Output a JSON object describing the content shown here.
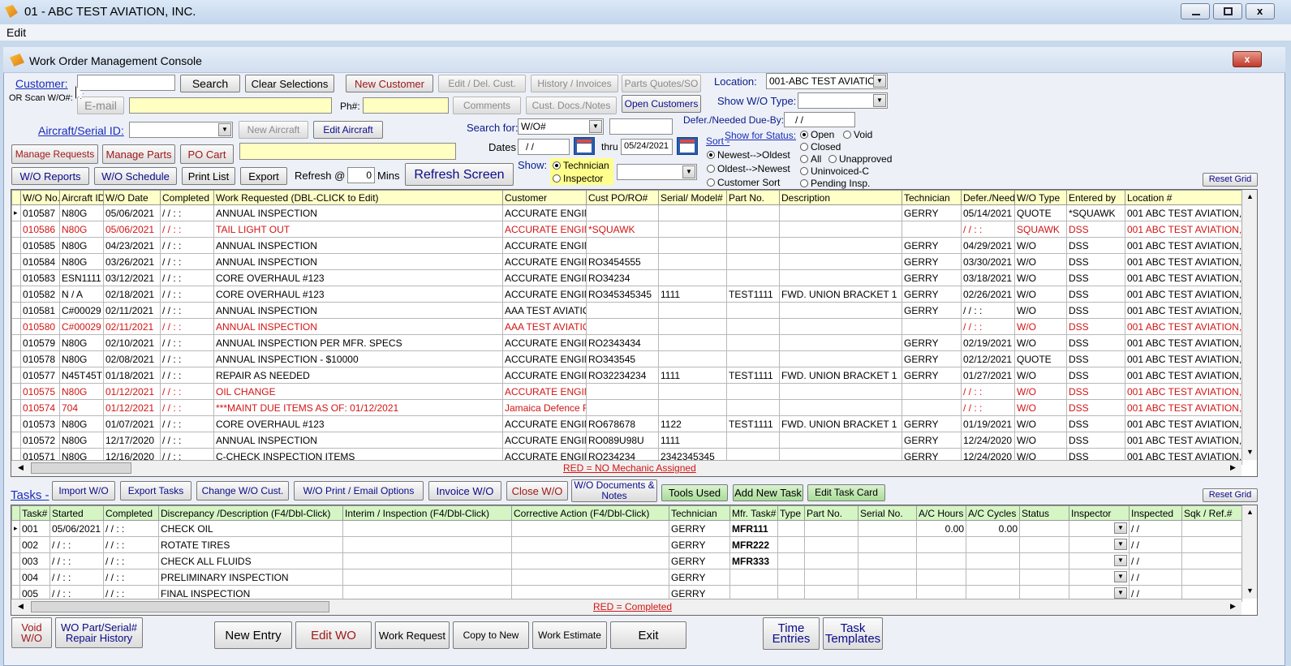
{
  "window": {
    "title": "01 - ABC TEST AVIATION, INC."
  },
  "menu": {
    "edit": "Edit"
  },
  "console": {
    "title": "Work Order Management Console",
    "close": "x"
  },
  "form": {
    "customer_label": "Customer:",
    "scan_label": "OR Scan W/O#:",
    "search": "Search",
    "clear": "Clear Selections",
    "new_customer": "New Customer",
    "edit_del_cust": "Edit / Del. Cust.",
    "history_invoices": "History / Invoices",
    "parts_quotes": "Parts Quotes/SO",
    "location_label": "Location:",
    "location_value": "001-ABC TEST AVIATIO",
    "email_label": "E-mail",
    "ph_label": "Ph#:",
    "comments": "Comments",
    "cust_docs": "Cust. Docs./Notes",
    "open_customers": "Open Customers",
    "show_wo_type_label": "Show W/O Type:",
    "aircraft_label": "Aircraft/Serial ID:",
    "new_aircraft": "New Aircraft",
    "edit_aircraft": "Edit Aircraft",
    "defer_label": "Defer./Needed Due-By:",
    "defer_value": "/ /",
    "search_for_label": "Search for:",
    "search_for_value": "W/O#",
    "dates_label": "Dates",
    "dates_from": "/ /",
    "thru_label": "thru",
    "dates_thru": "05/24/2021",
    "sort_label": "Sort -",
    "sort_newest": "Newest-->Oldest",
    "sort_oldest": "Oldest-->Newest",
    "sort_customer": "Customer Sort",
    "status_label": "Show for Status:",
    "status_open": "Open",
    "status_void": "Void",
    "status_closed": "Closed",
    "status_all": "All",
    "status_unapproved": "Unapproved",
    "status_uninvoiced": "Uninvoiced-C",
    "status_pending": "Pending Insp.",
    "manage_requests": "Manage Requests",
    "manage_parts": "Manage Parts",
    "po_cart": "PO Cart",
    "wo_reports": "W/O Reports",
    "wo_schedule": "W/O Schedule",
    "print_list": "Print List",
    "export": "Export",
    "refresh_label": "Refresh @",
    "refresh_value": "0",
    "mins_label": "Mins",
    "refresh_screen": "Refresh Screen",
    "show_label": "Show:",
    "show_technician": "Technician",
    "show_inspector": "Inspector",
    "reset_grid": "Reset Grid"
  },
  "wo_grid": {
    "columns": [
      "W/O No.",
      "Aircraft ID",
      "W/O Date",
      "Completed",
      "Work Requested    (DBL-CLICK to Edit)",
      "Customer",
      "Cust PO/RO#",
      "Serial/ Model#",
      "Part No.",
      "Description",
      "Technician",
      "Defer./Needed",
      "W/O Type",
      "Entered by",
      "Location #"
    ],
    "rows": [
      {
        "c": [
          "010587",
          "N80G",
          "05/06/2021",
          "/ /     :  :",
          "ANNUAL INSPECTION",
          "ACCURATE ENGIN",
          "",
          "",
          "",
          "",
          "GERRY",
          "05/14/2021",
          "QUOTE",
          "*SQUAWK",
          "001 ABC TEST AVIATION,"
        ],
        "red": false
      },
      {
        "c": [
          "010586",
          "N80G",
          "05/06/2021",
          "/ /     :  :",
          "TAIL LIGHT OUT",
          "ACCURATE ENGIN",
          "*SQUAWK",
          "",
          "",
          "",
          "",
          "/ /     :  :",
          "SQUAWK",
          "DSS",
          "001 ABC TEST AVIATION,"
        ],
        "red": true
      },
      {
        "c": [
          "010585",
          "N80G",
          "04/23/2021",
          "/ /     :  :",
          "ANNUAL INSPECTION",
          "ACCURATE ENGIN",
          "",
          "",
          "",
          "",
          "GERRY",
          "04/29/2021",
          "W/O",
          "DSS",
          "001 ABC TEST AVIATION,"
        ],
        "red": false
      },
      {
        "c": [
          "010584",
          "N80G",
          "03/26/2021",
          "/ /     :  :",
          "ANNUAL INSPECTION",
          "ACCURATE ENGIN",
          "RO3454555",
          "",
          "",
          "",
          "GERRY",
          "03/30/2021",
          "W/O",
          "DSS",
          "001 ABC TEST AVIATION,"
        ],
        "red": false
      },
      {
        "c": [
          "010583",
          "ESN1111",
          "03/12/2021",
          "/ /     :  :",
          "CORE OVERHAUL #123",
          "ACCURATE ENGIN",
          "RO34234",
          "",
          "",
          "",
          "GERRY",
          "03/18/2021",
          "W/O",
          "DSS",
          "001 ABC TEST AVIATION,"
        ],
        "red": false
      },
      {
        "c": [
          "010582",
          "N / A",
          "02/18/2021",
          "/ /     :  :",
          "CORE OVERHAUL #123",
          "ACCURATE ENGIN",
          "RO345345345",
          "1111",
          "TEST1111",
          "FWD.  UNION BRACKET 1",
          "GERRY",
          "02/26/2021",
          "W/O",
          "DSS",
          "001 ABC TEST AVIATION,"
        ],
        "red": false
      },
      {
        "c": [
          "010581",
          "C#00029",
          "02/11/2021",
          "/ /     :  :",
          "ANNUAL INSPECTION",
          "AAA TEST AVIATIO",
          "",
          "",
          "",
          "",
          "GERRY",
          "/ /     :  :",
          "W/O",
          "DSS",
          "001 ABC TEST AVIATION,"
        ],
        "red": false
      },
      {
        "c": [
          "010580",
          "C#00029",
          "02/11/2021",
          "/ /     :  :",
          "ANNUAL INSPECTION",
          "AAA TEST AVIATIO",
          "",
          "",
          "",
          "",
          "",
          "/ /     :  :",
          "W/O",
          "DSS",
          "001 ABC TEST AVIATION,"
        ],
        "red": true
      },
      {
        "c": [
          "010579",
          "N80G",
          "02/10/2021",
          "/ /     :  :",
          "ANNUAL INSPECTION PER MFR. SPECS",
          "ACCURATE ENGIN",
          "RO2343434",
          "",
          "",
          "",
          "GERRY",
          "02/19/2021",
          "W/O",
          "DSS",
          "001 ABC TEST AVIATION,"
        ],
        "red": false
      },
      {
        "c": [
          "010578",
          "N80G",
          "02/08/2021",
          "/ /     :  :",
          "ANNUAL INSPECTION - $10000",
          "ACCURATE ENGIN",
          "RO343545",
          "",
          "",
          "",
          "GERRY",
          "02/12/2021",
          "QUOTE",
          "DSS",
          "001 ABC TEST AVIATION,"
        ],
        "red": false
      },
      {
        "c": [
          "010577",
          "N45T45T",
          "01/18/2021",
          "/ /     :  :",
          "REPAIR AS NEEDED",
          "ACCURATE ENGIN",
          "RO32234234",
          "1111",
          "TEST1111",
          "FWD.  UNION BRACKET 1",
          "GERRY",
          "01/27/2021",
          "W/O",
          "DSS",
          "001 ABC TEST AVIATION,"
        ],
        "red": false
      },
      {
        "c": [
          "010575",
          "N80G",
          "01/12/2021",
          "/ /     :  :",
          "OIL CHANGE",
          "ACCURATE ENGIN",
          "",
          "",
          "",
          "",
          "",
          "/ /     :  :",
          "W/O",
          "DSS",
          "001 ABC TEST AVIATION,"
        ],
        "red": true
      },
      {
        "c": [
          "010574",
          "704",
          "01/12/2021",
          "/ /     :  :",
          "***MAINT DUE ITEMS AS OF: 01/12/2021",
          "Jamaica Defence F",
          "",
          "",
          "",
          "",
          "",
          "/ /     :  :",
          "W/O",
          "DSS",
          "001 ABC TEST AVIATION,"
        ],
        "red": true
      },
      {
        "c": [
          "010573",
          "N80G",
          "01/07/2021",
          "/ /     :  :",
          "CORE OVERHAUL #123",
          "ACCURATE ENGIN",
          "RO678678",
          "1122",
          "TEST1111",
          "FWD.  UNION BRACKET 1",
          "GERRY",
          "01/19/2021",
          "W/O",
          "DSS",
          "001 ABC TEST AVIATION,"
        ],
        "red": false
      },
      {
        "c": [
          "010572",
          "N80G",
          "12/17/2020",
          "/ /     :  :",
          "ANNUAL INSPECTION",
          "ACCURATE ENGIN",
          "RO089U98U",
          "1111",
          "",
          "",
          "GERRY",
          "12/24/2020",
          "W/O",
          "DSS",
          "001 ABC TEST AVIATION,"
        ],
        "red": false
      },
      {
        "c": [
          "010571",
          "N80G",
          "12/16/2020",
          "/ /     :  :",
          "C-CHECK INSPECTION ITEMS",
          "ACCURATE ENGIN",
          "RO234234",
          "2342345345",
          "",
          "",
          "GERRY",
          "12/24/2020",
          "W/O",
          "DSS",
          "001 ABC TEST AVIATION,"
        ],
        "red": false
      }
    ],
    "note": "RED = NO Mechanic Assigned"
  },
  "tasks": {
    "label": "Tasks -",
    "import_wo": "Import W/O",
    "export_tasks": "Export Tasks",
    "change_wo_cust": "Change W/O Cust.",
    "wo_print_email": "W/O Print / Email Options",
    "invoice_wo": "Invoice W/O",
    "close_wo": "Close W/O",
    "wo_documents": "W/O Documents & Notes",
    "tools_used": "Tools Used",
    "add_new_task": "Add New Task",
    "edit_task_card": "Edit Task Card",
    "reset_grid": "Reset Grid",
    "columns": [
      "Task#",
      "Started",
      "Completed",
      "Discrepancy /Description  (F4/Dbl-Click)",
      "Interim / Inspection (F4/Dbl-Click)",
      "Corrective Action (F4/Dbl-Click)",
      "Technician",
      "Mfr. Task#",
      "Type",
      "Part No.",
      "Serial No.",
      "A/C Hours",
      "A/C Cycles",
      "Status",
      "Inspector",
      "Inspected",
      "Sqk / Ref.#"
    ],
    "rows": [
      [
        "001",
        "05/06/2021",
        "/ /     :  :",
        "CHECK OIL",
        "",
        "",
        "GERRY",
        "MFR111",
        "",
        "",
        "",
        "0.00",
        "0.00",
        "",
        "",
        "/ /",
        ""
      ],
      [
        "002",
        "/ /     :  :",
        "/ /     :  :",
        "ROTATE TIRES",
        "",
        "",
        "GERRY",
        "MFR222",
        "",
        "",
        "",
        "",
        "",
        "",
        "",
        "/ /",
        ""
      ],
      [
        "003",
        "/ /     :  :",
        "/ /     :  :",
        "CHECK ALL FLUIDS",
        "",
        "",
        "GERRY",
        "MFR333",
        "",
        "",
        "",
        "",
        "",
        "",
        "",
        "/ /",
        ""
      ],
      [
        "004",
        "/ /     :  :",
        "/ /     :  :",
        "PRELIMINARY INSPECTION",
        "",
        "",
        "GERRY",
        "",
        "",
        "",
        "",
        "",
        "",
        "",
        "",
        "/ /",
        ""
      ],
      [
        "005",
        "/ /     :  :",
        "/ /     :  :",
        "FINAL INSPECTION",
        "",
        "",
        "GERRY",
        "",
        "",
        "",
        "",
        "",
        "",
        "",
        "",
        "/ /",
        ""
      ]
    ],
    "note": "RED = Completed"
  },
  "bottom": {
    "void_wo": "Void W/O",
    "wo_part_history": "WO Part/Serial# Repair History",
    "new_entry": "New Entry",
    "edit_wo": "Edit WO",
    "work_request": "Work Request",
    "copy_to_new": "Copy to New",
    "work_estimate": "Work Estimate",
    "exit": "Exit",
    "time_entries": "Time Entries",
    "task_templates": "Task Templates"
  }
}
